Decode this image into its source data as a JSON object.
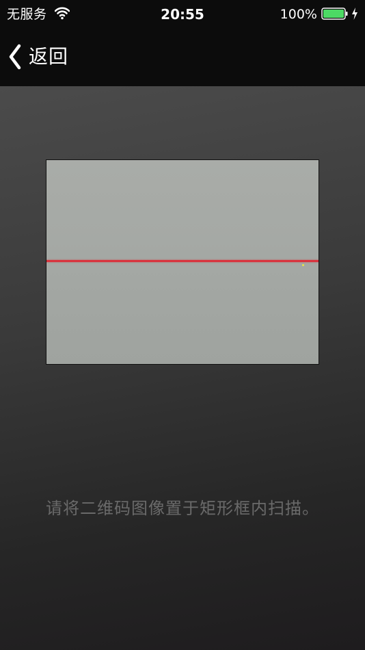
{
  "status_bar": {
    "carrier": "无服务",
    "time": "20:55",
    "battery_percent": "100%",
    "battery_level": 1.0,
    "battery_color": "#4cd964",
    "icons": [
      "wifi-icon",
      "battery-icon",
      "charging-bolt-icon"
    ]
  },
  "nav": {
    "back_label": "返回",
    "back_icon": "chevron-left-icon"
  },
  "scanner": {
    "hint": "请将二维码图像置于矩形框内扫描。",
    "scan_line_color": "#d8333d",
    "scan_line_position": 0.49
  }
}
